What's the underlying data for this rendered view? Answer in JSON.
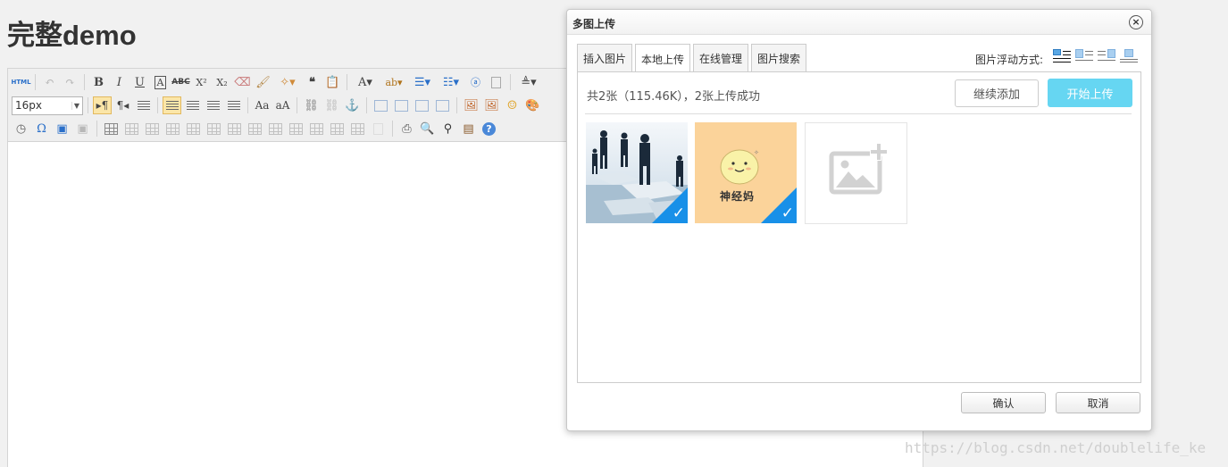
{
  "page": {
    "title": "完整demo"
  },
  "toolbar": {
    "html_label": "HTML",
    "font_size_value": "16px",
    "bold": "B",
    "italic": "I",
    "underline": "U",
    "strike": "ABC",
    "superscript": "X²",
    "subscript": "X₂",
    "quote": "❝",
    "font_color": "A",
    "omega": "Ω",
    "help": "?"
  },
  "dialog": {
    "title": "多图上传",
    "close": "×",
    "tabs": [
      {
        "label": "插入图片",
        "active": false
      },
      {
        "label": "本地上传",
        "active": true
      },
      {
        "label": "在线管理",
        "active": false
      },
      {
        "label": "图片搜索",
        "active": false
      }
    ],
    "float_label": "图片浮动方式:",
    "status": "共2张（115.46K），2张上传成功",
    "continue_add": "继续添加",
    "start_upload": "开始上传",
    "thumbnails": [
      {
        "name": "business-silhouettes-image",
        "uploaded": true
      },
      {
        "name": "cartoon-face-image",
        "uploaded": true,
        "caption": "神经妈"
      }
    ],
    "confirm": "确认",
    "cancel": "取消"
  },
  "watermark": "https://blog.csdn.net/doublelife_ke",
  "colors": {
    "accent": "#1890e8",
    "start_button": "#66d6f2"
  }
}
